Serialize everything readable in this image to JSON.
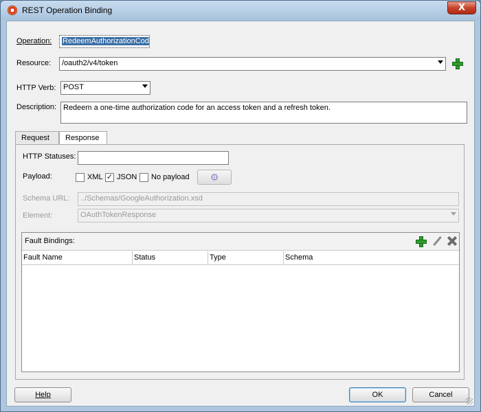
{
  "window": {
    "title": "REST Operation Binding",
    "close_glyph": "X"
  },
  "form": {
    "operation_label": "Operation:",
    "operation_value": "RedeemAuthorizationCode",
    "resource_label": "Resource:",
    "resource_value": "/oauth2/v4/token",
    "verb_label": "HTTP Verb:",
    "verb_value": "POST",
    "description_label": "Description:",
    "description_value": "Redeem a one-time authorization code for an access token and a refresh token."
  },
  "tabs": [
    {
      "label": "Request"
    },
    {
      "label": "Response"
    }
  ],
  "response": {
    "statuses_label": "HTTP Statuses:",
    "statuses_value": "",
    "payload_label": "Payload:",
    "xml_label": "XML",
    "json_label": "JSON",
    "nopayload_label": "No payload",
    "schema_label": "Schema URL:",
    "schema_value": "../Schemas/GoogleAuthorization.xsd",
    "element_label": "Element:",
    "element_value": "OAuthTokenResponse"
  },
  "fault": {
    "title": "Fault Bindings:",
    "columns": [
      "Fault Name",
      "Status",
      "Type",
      "Schema"
    ]
  },
  "buttons": {
    "help": "Help",
    "ok": "OK",
    "cancel": "Cancel"
  },
  "state": {
    "xml_checked": false,
    "json_checked": true,
    "nopayload_checked": false
  },
  "colors": {
    "selection": "#3a6ea5",
    "add_green": "#2e9c2e"
  }
}
